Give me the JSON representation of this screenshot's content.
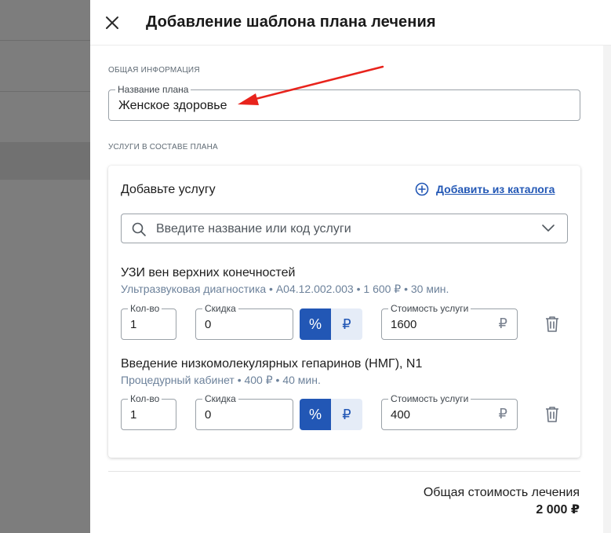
{
  "drawer": {
    "title": "Добавление шаблона плана лечения",
    "general_section": "Общая информация",
    "plan_name_label": "Название плана",
    "plan_name_value": "Женское здоровье",
    "services_section": "Услуги в составе плана"
  },
  "services_card": {
    "title": "Добавьте услугу",
    "add_from_catalog": "Добавить из каталога",
    "search_placeholder": "Введите название или код услуги",
    "items": [
      {
        "name": "УЗИ вен верхних конечностей",
        "meta": "Ультразвуковая диагностика • A04.12.002.003 • 1 600 ₽ • 30 мин.",
        "qty_label": "Кол-во",
        "qty": "1",
        "discount_label": "Скидка",
        "discount": "0",
        "cost_label": "Стоимость услуги",
        "cost": "1600"
      },
      {
        "name": "Введение низкомолекулярных гепаринов (НМГ), N1",
        "meta": "Процедурный кабинет • 400 ₽ • 40 мин.",
        "qty_label": "Кол-во",
        "qty": "1",
        "discount_label": "Скидка",
        "discount": "0",
        "cost_label": "Стоимость услуги",
        "cost": "400"
      }
    ],
    "percent_symbol": "%",
    "ruble_symbol": "₽"
  },
  "total": {
    "label": "Общая стоимость лечения",
    "value": "2 000 ₽"
  },
  "colors": {
    "accent": "#2257b5",
    "accent_light": "#e5ecf7",
    "meta_text": "#6d829b",
    "annotation_arrow": "#e8231c"
  },
  "icons": {
    "close": "close-icon",
    "add": "plus-circle-icon",
    "search": "search-icon",
    "dropdown": "chevron-down-icon",
    "delete": "trash-icon"
  }
}
